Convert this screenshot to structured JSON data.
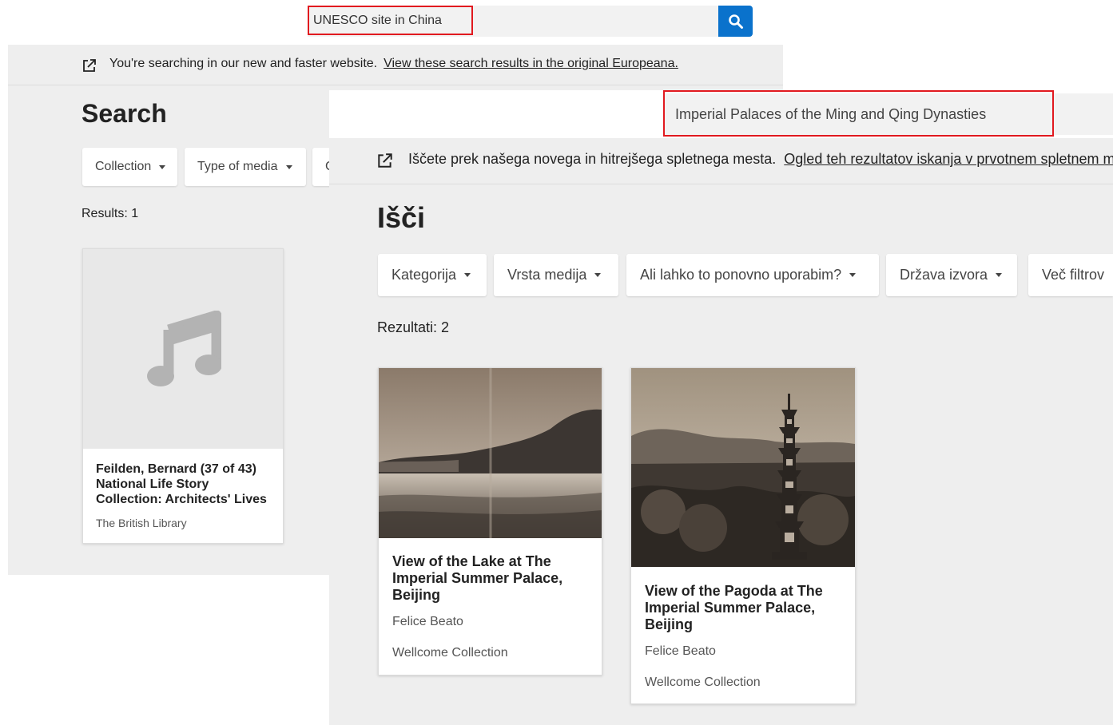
{
  "english_window": {
    "search": {
      "query": "UNESCO site in China"
    },
    "notice": {
      "text": "You're searching in our new and faster website.",
      "link": "View these search results in the original Europeana."
    },
    "page_title": "Search",
    "filters": [
      "Collection",
      "Type of media",
      "C"
    ],
    "results_label": "Results: 1",
    "cards": [
      {
        "title": "Feilden, Bernard (37 of 43) National Life Story Collection: Architects' Lives",
        "source": "The British Library",
        "media_icon": "music-note-icon"
      }
    ]
  },
  "slovenian_window": {
    "search": {
      "query": "Imperial Palaces of the Ming and Qing Dynasties"
    },
    "notice": {
      "text": "Iščete prek našega novega in hitrejšega spletnega mesta.",
      "link": "Ogled teh rezultatov iskanja v prvotnem spletnem mestu Europeana."
    },
    "page_title": "Išči",
    "filters": [
      "Kategorija",
      "Vrsta medija",
      "Ali lahko to ponovno uporabim?",
      "Država izvora",
      "Več filtrov"
    ],
    "results_label": "Rezultati: 2",
    "cards": [
      {
        "title": "View of the Lake at The Imperial Summer Palace, Beijing",
        "creator": "Felice Beato",
        "source": "Wellcome Collection"
      },
      {
        "title": "View of the Pagoda at The Imperial Summer Palace, Beijing",
        "creator": "Felice Beato",
        "source": "Wellcome Collection"
      }
    ]
  },
  "colors": {
    "search_button": "#0a72cc",
    "highlight": "#e1191f",
    "page_background": "#eeeeee"
  }
}
